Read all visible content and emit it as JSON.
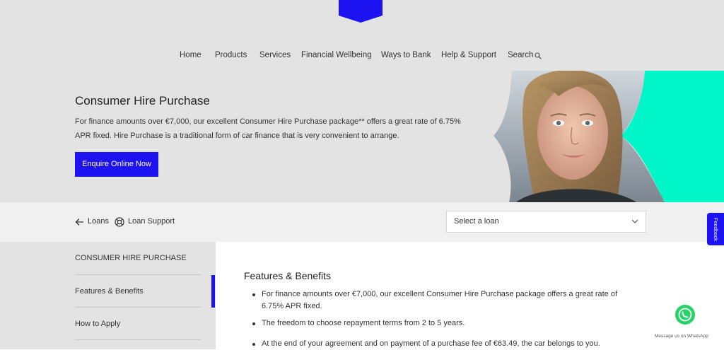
{
  "nav": {
    "items": [
      "Home",
      "Products",
      "Services",
      "Financial Wellbeing",
      "Ways to Bank",
      "Help & Support",
      "Search"
    ]
  },
  "hero": {
    "title": "Consumer Hire Purchase",
    "description": "For finance amounts over €7,000, our excellent Consumer Hire Purchase package** offers a great rate of 6.75% APR fixed. Hire Purchase is a traditional form of car finance that is very convenient to arrange.",
    "button_label": "Enquire Online Now"
  },
  "subbar": {
    "back_label": "Loans",
    "support_label": "Loan Support",
    "select_label": "Select a loan"
  },
  "sidebar": {
    "items": [
      "CONSUMER HIRE PURCHASE",
      "Features & Benefits",
      "How to Apply"
    ]
  },
  "content": {
    "title": "Features & Benefits",
    "bullets": [
      "For finance amounts over €7,000, our excellent Consumer Hire Purchase package offers a great rate of 6.75% APR fixed.",
      "The freedom to choose repayment terms from 2 to 5 years.",
      "At the end of your agreement and on payment of a purchase fee of €63.49, the car belongs to you."
    ]
  },
  "widgets": {
    "feedback_label": "Feedback",
    "whatsapp_label": "Message us on WhatsApp"
  },
  "colors": {
    "brand_blue": "#1d12f0",
    "accent_mint": "#00f5c8",
    "hero_bg": "#e3e3e3"
  }
}
